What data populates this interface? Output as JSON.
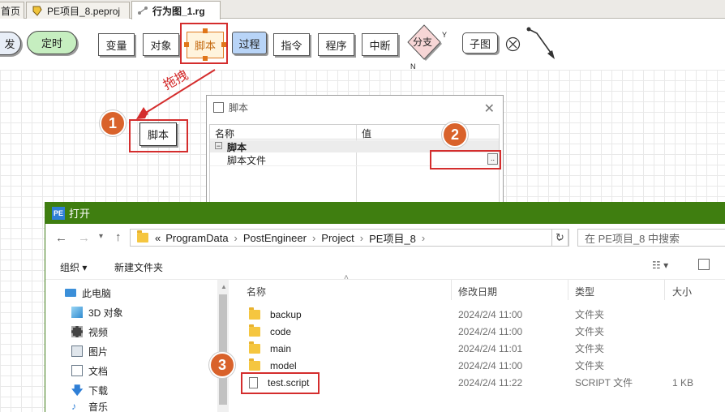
{
  "tabs": [
    {
      "label": "首页"
    },
    {
      "label": "PE项目_8.peproj"
    },
    {
      "label": "行为图_1.rg"
    }
  ],
  "toolbar": {
    "trigger_label": "发",
    "timer_label": "定时",
    "variable_label": "变量",
    "object_label": "对象",
    "script_label": "脚本",
    "process_label": "过程",
    "command_label": "指令",
    "program_label": "程序",
    "interrupt_label": "中断",
    "branch_label": "分支",
    "branch_yes": "Y",
    "branch_no": "N",
    "subgraph_label": "子图"
  },
  "annotation": {
    "drag_label": "拖拽",
    "badge1": "1",
    "badge2": "2",
    "badge3": "3"
  },
  "canvas_node": {
    "label": "脚本"
  },
  "prop_dialog": {
    "title": "脚本",
    "col_name": "名称",
    "col_value": "值",
    "group": "脚本",
    "group_toggle": "−",
    "field_label": "脚本文件",
    "browse_label": ".."
  },
  "open_dialog": {
    "title": "打开",
    "app_icon": "PE",
    "path": [
      "«",
      "ProgramData",
      "PostEngineer",
      "Project",
      "PE项目_8"
    ],
    "search_placeholder": "在 PE项目_8 中搜索",
    "organize_label": "组织 ▾",
    "new_folder_label": "新建文件夹",
    "nav_items": [
      {
        "label": "此电脑",
        "icon": "pc-icon"
      },
      {
        "label": "3D 对象",
        "icon": "cube-icon"
      },
      {
        "label": "视频",
        "icon": "video-icon"
      },
      {
        "label": "图片",
        "icon": "picture-icon"
      },
      {
        "label": "文档",
        "icon": "document-icon"
      },
      {
        "label": "下载",
        "icon": "download-icon"
      },
      {
        "label": "音乐",
        "icon": "music-icon"
      }
    ],
    "columns": {
      "name": "名称",
      "date": "修改日期",
      "type": "类型",
      "size": "大小"
    },
    "files": [
      {
        "name": "backup",
        "date": "2024/2/4 11:00",
        "type": "文件夹",
        "size": "",
        "kind": "folder"
      },
      {
        "name": "code",
        "date": "2024/2/4 11:00",
        "type": "文件夹",
        "size": "",
        "kind": "folder"
      },
      {
        "name": "main",
        "date": "2024/2/4 11:01",
        "type": "文件夹",
        "size": "",
        "kind": "folder"
      },
      {
        "name": "model",
        "date": "2024/2/4 11:00",
        "type": "文件夹",
        "size": "",
        "kind": "folder"
      },
      {
        "name": "test.script",
        "date": "2024/2/4 11:22",
        "type": "SCRIPT 文件",
        "size": "1 KB",
        "kind": "file"
      }
    ]
  },
  "colors": {
    "timer_fill": "#c6eec0",
    "process_fill": "#b8d4f7",
    "script_fill": "#fff4dd",
    "highlight_red": "#d42d2d",
    "badge_orange": "#d9622b",
    "dialog_green": "#3f7e10"
  }
}
